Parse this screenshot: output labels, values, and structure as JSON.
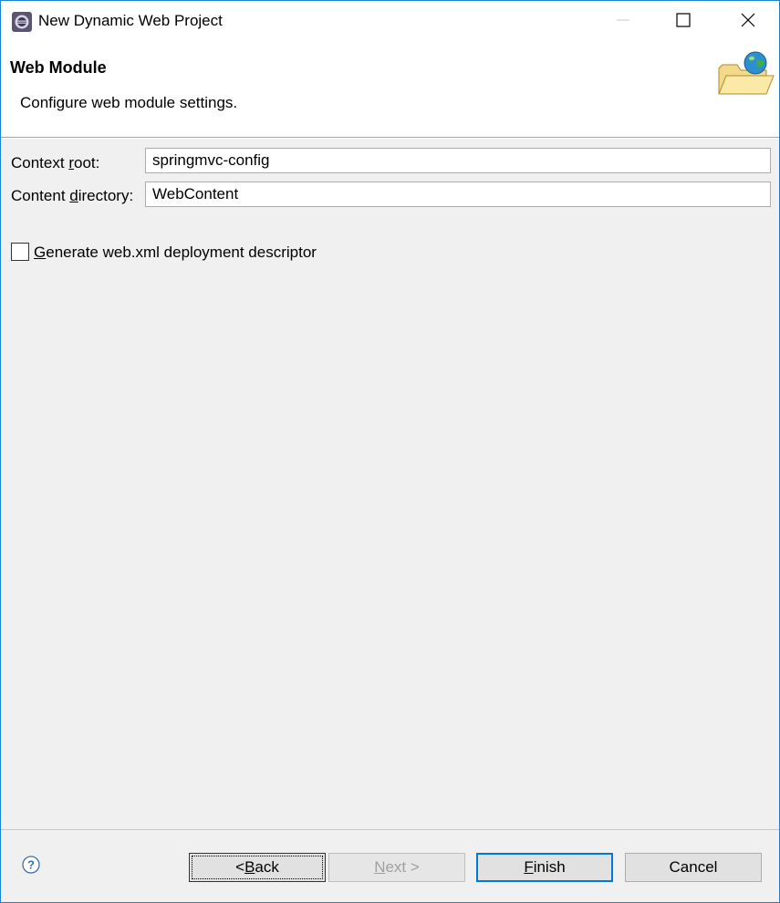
{
  "window": {
    "title": "New Dynamic Web Project",
    "icons": {
      "app": "eclipse-icon",
      "minimize": "minimize-icon",
      "maximize": "maximize-icon",
      "close": "close-icon"
    }
  },
  "banner": {
    "title": "Web Module",
    "description": "Configure web module settings.",
    "icon": "folder-globe-icon"
  },
  "form": {
    "context_root": {
      "label_pre": "Context ",
      "label_mnemonic": "r",
      "label_post": "oot:",
      "value": "springmvc-config"
    },
    "content_directory": {
      "label_pre": "Content ",
      "label_mnemonic": "d",
      "label_post": "irectory:",
      "value": "WebContent"
    },
    "generate_descriptor": {
      "label_mnemonic": "G",
      "label_post": "enerate web.xml deployment descriptor",
      "checked": false
    }
  },
  "footer": {
    "help_icon": "help-icon",
    "back": {
      "pre": "< ",
      "mnemonic": "B",
      "post": "ack"
    },
    "next": {
      "mnemonic": "N",
      "post": "ext >",
      "enabled": false
    },
    "finish": {
      "mnemonic": "F",
      "post": "inish"
    },
    "cancel": "Cancel"
  },
  "colors": {
    "accent": "#0078d7",
    "dialog_bg": "#f0f0f0",
    "banner_bg": "#ffffff"
  }
}
